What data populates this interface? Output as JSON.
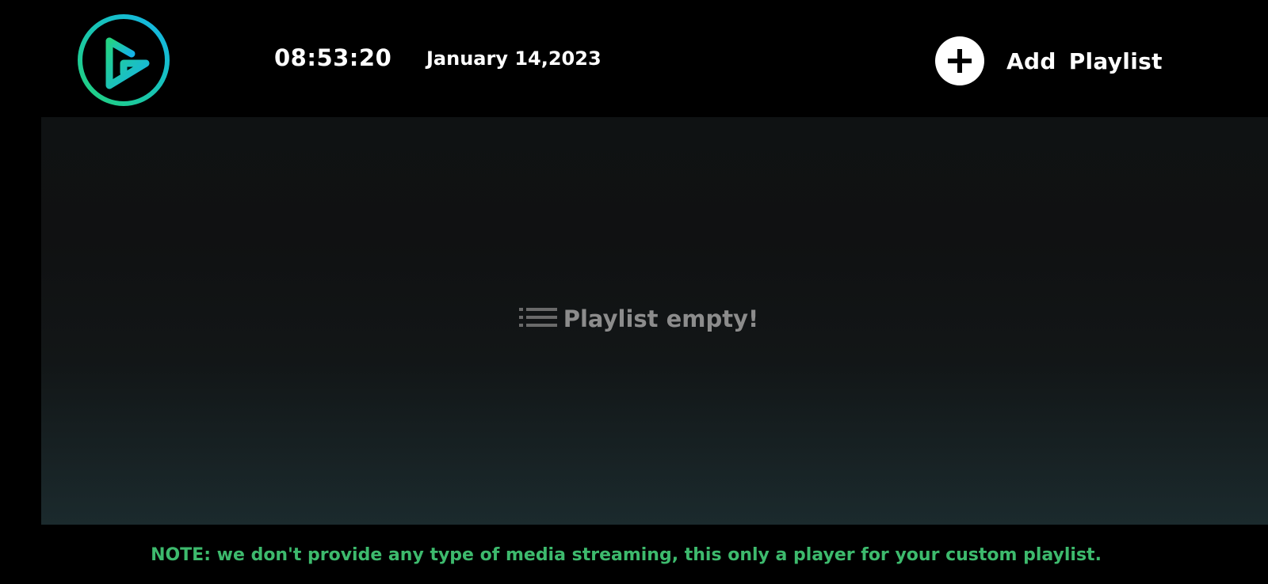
{
  "header": {
    "time": "08:53:20",
    "date": "January 14,2023",
    "add_playlist_label": "Add  Playlist",
    "logo_icon": "play-logo-icon",
    "add_icon": "plus-circle-icon"
  },
  "main": {
    "empty_icon": "list-icon",
    "empty_message": "Playlist empty!"
  },
  "footer": {
    "note": "NOTE: we don't provide any type of media streaming, this only a player for your custom playlist."
  },
  "colors": {
    "background": "#000000",
    "accent_green": "#3dba6d",
    "logo_gradient_start": "#1fd38a",
    "logo_gradient_end": "#14b8e6",
    "empty_text": "#8c8c8c"
  }
}
